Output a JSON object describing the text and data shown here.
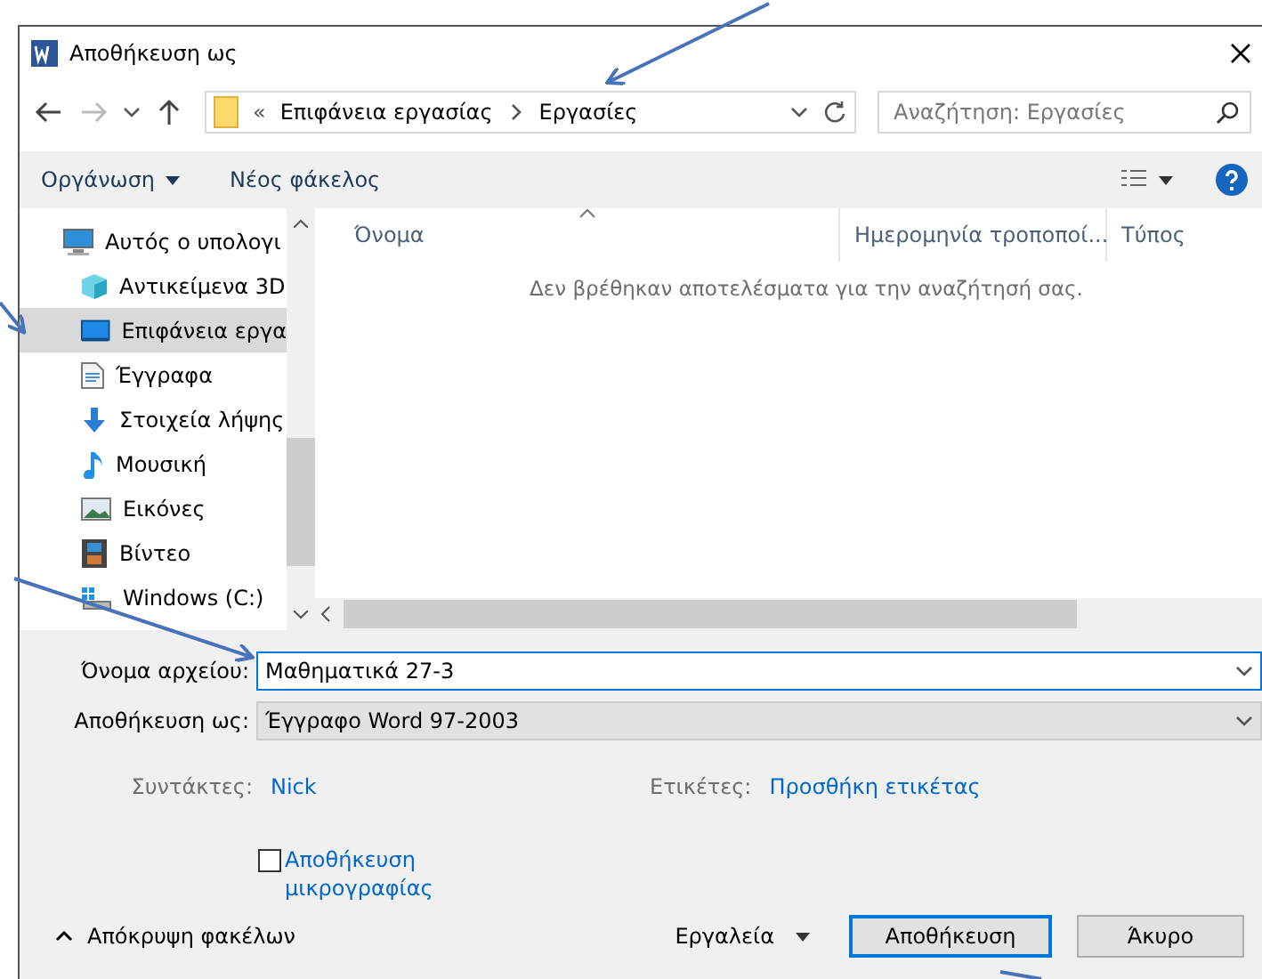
{
  "window": {
    "title": "Αποθήκευση ως"
  },
  "address": {
    "overflow_mark": "«",
    "path": [
      {
        "label": "Επιφάνεια εργασίας"
      },
      {
        "label": "Εργασίες"
      }
    ]
  },
  "search": {
    "placeholder": "Αναζήτηση: Εργασίες"
  },
  "toolbar": {
    "organize": "Οργάνωση",
    "new_folder": "Νέος φάκελος"
  },
  "nav": {
    "items": [
      {
        "label": "Αυτός ο υπολογι",
        "kind": "computer",
        "selected": false,
        "children": [
          {
            "label": "Αντικείμενα 3D",
            "kind": "cube",
            "selected": false
          },
          {
            "label": "Επιφάνεια εργα",
            "kind": "desktop",
            "selected": true
          },
          {
            "label": "Έγγραφα",
            "kind": "document",
            "selected": false
          },
          {
            "label": "Στοιχεία λήψης",
            "kind": "download",
            "selected": false
          },
          {
            "label": "Μουσική",
            "kind": "music",
            "selected": false
          },
          {
            "label": "Εικόνες",
            "kind": "pictures",
            "selected": false
          },
          {
            "label": "Βίντεο",
            "kind": "video",
            "selected": false
          },
          {
            "label": "Windows (C:)",
            "kind": "drive",
            "selected": false
          }
        ]
      }
    ]
  },
  "columns": [
    {
      "label": "Όνομα",
      "sorted": true
    },
    {
      "label": "Ημερομηνία τροποποί...",
      "sorted": false
    },
    {
      "label": "Τύπος",
      "sorted": false
    }
  ],
  "empty_message": "Δεν βρέθηκαν αποτελέσματα για την αναζήτησή σας.",
  "form": {
    "file_name": {
      "label": "Όνομα αρχείου:",
      "value": "Μαθηματικά 27-3"
    },
    "save_as_type": {
      "label": "Αποθήκευση ως:",
      "value": "Έγγραφο Word 97-2003"
    },
    "authors": {
      "label": "Συντάκτες:",
      "value": "Nick"
    },
    "tags": {
      "label": "Ετικέτες:",
      "value": "Προσθήκη ετικέτας"
    },
    "thumbnail": {
      "label": "Αποθήκευση μικρογραφίας",
      "checked": false
    }
  },
  "footer": {
    "hide_folders": "Απόκρυψη φακέλων",
    "tools": "Εργαλεία",
    "buttons": [
      {
        "label": "Αποθήκευση",
        "default": true
      },
      {
        "label": "Άκυρο",
        "default": false
      }
    ]
  }
}
